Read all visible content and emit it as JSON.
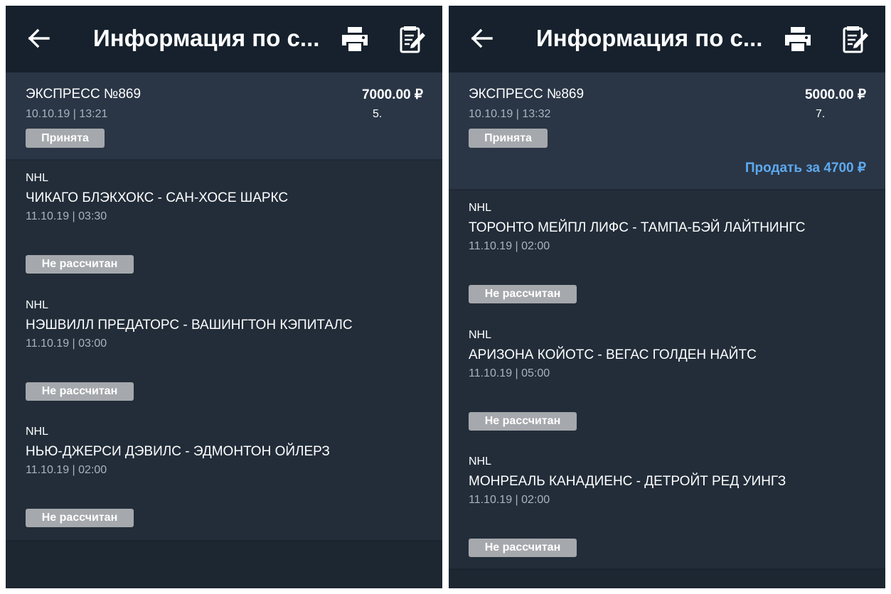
{
  "screens": [
    {
      "header": {
        "title": "Информация по с..."
      },
      "bet": {
        "name": "ЭКСПРЕСС №869",
        "datetime": "10.10.19 | 13:21",
        "amount": "7000.00 ₽",
        "coefficient": "5.",
        "status": "Принята"
      },
      "events": [
        {
          "league": "NHL",
          "match": "ЧИКАГО БЛЭКХОКС - САН-ХОСЕ ШАРКС",
          "datetime": "11.10.19 | 03:30",
          "status": "Не рассчитан"
        },
        {
          "league": "NHL",
          "match": "НЭШВИЛЛ ПРЕДАТОРС - ВАШИНГТОН КЭПИТАЛС",
          "datetime": "11.10.19 | 03:00",
          "status": "Не рассчитан"
        },
        {
          "league": "NHL",
          "match": "НЬЮ-ДЖЕРСИ ДЭВИЛС - ЭДМОНТОН ОЙЛЕРЗ",
          "datetime": "11.10.19 | 02:00",
          "status": "Не рассчитан"
        }
      ]
    },
    {
      "header": {
        "title": "Информация по с..."
      },
      "bet": {
        "name": "ЭКСПРЕСС №869",
        "datetime": "10.10.19 | 13:32",
        "amount": "5000.00 ₽",
        "coefficient": "7.",
        "status": "Принята",
        "sell_label": "Продать за 4700 ₽"
      },
      "events": [
        {
          "league": "NHL",
          "match": "ТОРОНТО МЕЙПЛ ЛИФС - ТАМПА-БЭЙ ЛАЙТНИНГС",
          "datetime": "11.10.19 | 02:00",
          "status": "Не рассчитан"
        },
        {
          "league": "NHL",
          "match": "АРИЗОНА КОЙОТС - ВЕГАС ГОЛДЕН НАЙТС",
          "datetime": "11.10.19 | 05:00",
          "status": "Не рассчитан"
        },
        {
          "league": "NHL",
          "match": "МОНРЕАЛЬ КАНАДИЕНС - ДЕТРОЙТ РЕД УИНГЗ",
          "datetime": "11.10.19 | 02:00",
          "status": "Не рассчитан"
        }
      ]
    }
  ],
  "colors": {
    "appbar": "#16212d",
    "panel": "#222d39",
    "summary": "#2a3646",
    "badge": "#a5a8ac",
    "sell_link": "#5ea9ef"
  },
  "icons": [
    "back-arrow-icon",
    "printer-icon",
    "edit-note-icon"
  ]
}
